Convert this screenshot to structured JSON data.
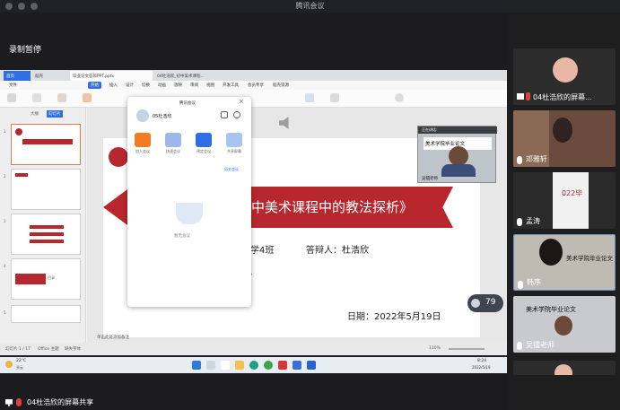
{
  "window": {
    "title": "腾讯会议"
  },
  "recording": {
    "status": "录制暂停"
  },
  "share": {
    "tabs": [
      {
        "label": "首页"
      },
      {
        "label": "稻壳"
      },
      {
        "label": "毕业论文答辩PPT.pptx"
      },
      {
        "label": "04杜浩欣_初中美术课程..."
      }
    ],
    "ribbon_menu": [
      "文件",
      "开始",
      "插入",
      "设计",
      "切换",
      "动画",
      "放映",
      "审阅",
      "视图",
      "开发工具",
      "会员专享",
      "稻壳资源"
    ],
    "ribbon_active": "开始",
    "panel_tabs": [
      "大纲",
      "幻灯片"
    ],
    "slide_numbers": [
      "1",
      "2",
      "3",
      "4",
      "5"
    ],
    "thumb_label": "目录",
    "slide": {
      "title": "初中美术课程中的教法探析》",
      "class": "学4班",
      "respondent": "答辩人：杜浩欣",
      "date": "日期：2022年5月19日",
      "page_mark": "5"
    },
    "statusbar": {
      "page": "幻灯片 1 / 17",
      "theme": "Office 主题",
      "font": "缺失字体",
      "notes": "单击此处添加备注",
      "zoom": "110%"
    },
    "taskbar": {
      "weather": "22°C",
      "weather_desc": "多云",
      "time": "8:24",
      "date": "2022/5/19"
    },
    "speaker_badge": "79"
  },
  "popup": {
    "header": "腾讯会议",
    "user": "05杜浩欣",
    "actions": [
      {
        "label": "加入会议",
        "color": "#f07c24"
      },
      {
        "label": "快速会议",
        "color": "#9fb6ea"
      },
      {
        "label": "预定会议",
        "color": "#2f6fe4"
      },
      {
        "label": "共享屏幕",
        "color": "#a9c4ee"
      }
    ],
    "history_link": "历史会议",
    "empty_text": "暂无会议"
  },
  "mini_video": {
    "label": "正在讲话:",
    "name": "吴镭老师",
    "banner": "美术学院毕业论文"
  },
  "participants": [
    {
      "name": "04杜浩欣的屏幕..."
    },
    {
      "name": "邓雅轩"
    },
    {
      "name": "孟涛",
      "banner": "022毕"
    },
    {
      "name": "韩序",
      "banner": "美术学院毕业论文"
    },
    {
      "name": "吴镭老师",
      "banner": "美术学院毕业论文"
    }
  ],
  "bottom": {
    "share_label": "04杜浩欣的屏幕共享"
  },
  "colors": {
    "accent_red": "#b8272d",
    "share_bg": "#f3f3f3",
    "dark_bg": "#1c1c1e"
  },
  "icons": [
    "mic-icon",
    "speaker-icon",
    "settings-icon",
    "close-icon",
    "coffee-cup-icon"
  ]
}
